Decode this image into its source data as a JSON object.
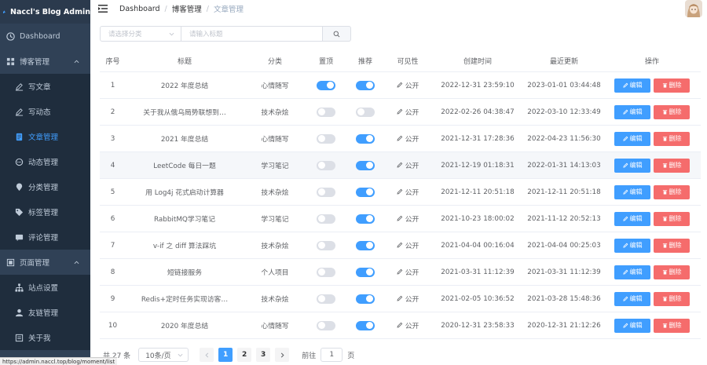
{
  "app": {
    "title": "Naccl's Blog Admin"
  },
  "sidebar": {
    "items": [
      {
        "label": "Dashboard",
        "icon": "dashboard-icon",
        "type": "top"
      },
      {
        "label": "博客管理",
        "icon": "grid-icon",
        "type": "group",
        "expanded": true
      },
      {
        "label": "写文章",
        "icon": "pen-icon",
        "type": "sub"
      },
      {
        "label": "写动态",
        "icon": "pen-icon",
        "type": "sub"
      },
      {
        "label": "文章管理",
        "icon": "document-icon",
        "type": "sub",
        "active": true
      },
      {
        "label": "动态管理",
        "icon": "chat-icon",
        "type": "sub"
      },
      {
        "label": "分类管理",
        "icon": "location-icon",
        "type": "sub"
      },
      {
        "label": "标签管理",
        "icon": "tag-icon",
        "type": "sub"
      },
      {
        "label": "评论管理",
        "icon": "comment-icon",
        "type": "sub"
      },
      {
        "label": "页面管理",
        "icon": "page-icon",
        "type": "group",
        "expanded": true
      },
      {
        "label": "站点设置",
        "icon": "sitemap-icon",
        "type": "sub"
      },
      {
        "label": "友链管理",
        "icon": "user-icon",
        "type": "sub"
      },
      {
        "label": "关于我",
        "icon": "about-icon",
        "type": "sub"
      }
    ]
  },
  "header": {
    "breadcrumb": [
      "Dashboard",
      "博客管理",
      "文章管理"
    ]
  },
  "filters": {
    "category_placeholder": "请选择分类",
    "title_placeholder": "请输入标题"
  },
  "table": {
    "columns": [
      "序号",
      "标题",
      "分类",
      "置顶",
      "推荐",
      "可见性",
      "创建时间",
      "最近更新",
      "操作"
    ],
    "edit_label": "编辑",
    "delete_label": "删除",
    "rows": [
      {
        "no": "1",
        "title": "2022 年度总结",
        "category": "心情随写",
        "top": true,
        "recommend": true,
        "visibility": "公开",
        "created": "2022-12-31 23:59:10",
        "updated": "2023-01-01 03:44:48"
      },
      {
        "no": "2",
        "title": "关于我从俄乌局势联想到…",
        "category": "技术杂烩",
        "top": false,
        "recommend": false,
        "visibility": "公开",
        "created": "2022-02-26 04:38:47",
        "updated": "2022-03-10 12:33:49"
      },
      {
        "no": "3",
        "title": "2021 年度总结",
        "category": "心情随写",
        "top": false,
        "recommend": true,
        "visibility": "公开",
        "created": "2021-12-31 17:28:36",
        "updated": "2022-04-23 11:56:30"
      },
      {
        "no": "4",
        "title": "LeetCode 每日一题",
        "category": "学习笔记",
        "top": false,
        "recommend": true,
        "visibility": "公开",
        "created": "2021-12-19 01:18:31",
        "updated": "2022-01-31 14:13:03"
      },
      {
        "no": "5",
        "title": "用 Log4j 花式启动计算器",
        "category": "技术杂烩",
        "top": false,
        "recommend": true,
        "visibility": "公开",
        "created": "2021-12-11 20:51:18",
        "updated": "2021-12-11 20:51:18"
      },
      {
        "no": "6",
        "title": "RabbitMQ学习笔记",
        "category": "学习笔记",
        "top": false,
        "recommend": true,
        "visibility": "公开",
        "created": "2021-10-23 18:00:02",
        "updated": "2021-11-12 20:52:13"
      },
      {
        "no": "7",
        "title": "v-if 之 diff 算法踩坑",
        "category": "技术杂烩",
        "top": false,
        "recommend": true,
        "visibility": "公开",
        "created": "2021-04-04 00:16:04",
        "updated": "2021-04-04 00:25:03"
      },
      {
        "no": "8",
        "title": "短链接服务",
        "category": "个人项目",
        "top": false,
        "recommend": true,
        "visibility": "公开",
        "created": "2021-03-31 11:12:39",
        "updated": "2021-03-31 11:12:39"
      },
      {
        "no": "9",
        "title": "Redis+定时任务实现访客…",
        "category": "技术杂烩",
        "top": false,
        "recommend": true,
        "visibility": "公开",
        "created": "2021-02-05 10:36:52",
        "updated": "2021-03-28 15:48:36"
      },
      {
        "no": "10",
        "title": "2020 年度总结",
        "category": "心情随写",
        "top": false,
        "recommend": true,
        "visibility": "公开",
        "created": "2020-12-31 23:58:33",
        "updated": "2020-12-31 21:12:26"
      }
    ]
  },
  "pagination": {
    "total_label": "共 27 条",
    "page_size": "10条/页",
    "pages": [
      "1",
      "2",
      "3"
    ],
    "current": "1",
    "goto_prefix": "前往",
    "goto_value": "1",
    "goto_suffix": "页"
  },
  "statusbar": {
    "url": "https://admin.naccl.top/blog/moment/list"
  },
  "colors": {
    "primary": "#409eff",
    "danger": "#f56c6c",
    "sidebar": "#304156"
  }
}
